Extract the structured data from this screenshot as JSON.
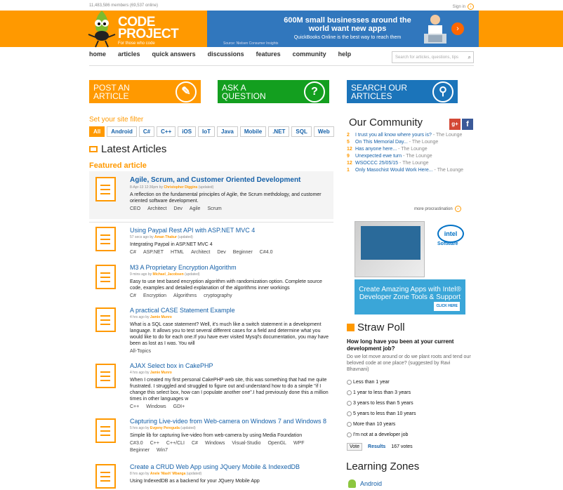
{
  "topbar": {
    "members": "11,483,586 members (69,537 online)",
    "signin": "Sign in"
  },
  "logo": {
    "line1": "CODE",
    "line2": "PROJECT",
    "tagline": "For those who code"
  },
  "ad": {
    "headline": "600M small businesses around the world want new apps",
    "sub": "QuickBooks Online is the best way to reach them",
    "source": "Source: Nielsen Consumer Insights"
  },
  "nav": [
    "home",
    "articles",
    "quick answers",
    "discussions",
    "features",
    "community",
    "help"
  ],
  "search": {
    "placeholder": "Search for articles, questions, tips"
  },
  "actions": {
    "post_article": "POST AN ARTICLE",
    "ask_question": "ASK A QUESTION",
    "search_articles": "SEARCH OUR ARTICLES"
  },
  "filter": {
    "title": "Set your site filter",
    "chips": [
      "All",
      "Android",
      "C#",
      "C++",
      "iOS",
      "IoT",
      "Java",
      "Mobile",
      ".NET",
      "SQL",
      "Web"
    ]
  },
  "latest": {
    "title": "Latest Articles",
    "featured_label": "Featured article"
  },
  "articles": [
    {
      "title": "Agile, Scrum, and Customer Oriented Development",
      "meta": "8-Apr-13 12:36pm by",
      "author": "Christopher Diggins",
      "updated": "(updated)",
      "desc": "A reflection on the fundamental principles of Agile, the Scrum methdology, and customer oriented software development.",
      "tags": [
        "CEO",
        "Architect",
        "Dev",
        "Agile",
        "Scrum"
      ]
    },
    {
      "title": "Using Paypal Rest API with ASP.NET MVC 4",
      "meta": "57 secs ago by",
      "author": "Aman Thakur",
      "updated": "(updated)",
      "desc": "Integrating Paypal in ASP.NET MVC 4",
      "tags": [
        "C#",
        "ASP.NET",
        "HTML",
        "Architect",
        "Dev",
        "Beginner",
        "C#4.0"
      ]
    },
    {
      "title": "M3 A Proprietary Encryption Algorithm",
      "meta": "9 mins ago by",
      "author": "Michael_Jacobsen",
      "updated": "(updated)",
      "desc": "Easy to use text based encryption algorithm with randomization option. Complete source code, examples and detailed explanation of the algorithms inner workings",
      "tags": [
        "C#",
        "Encryption",
        "Algorithms",
        "cryptography"
      ]
    },
    {
      "title": "A practical CASE Statement Example",
      "meta": "4 hrs ago by",
      "author": "Jamie Munro",
      "updated": "",
      "desc": "What is a SQL case statement? Well, it's much like a switch statement in a development language. It allows you to test several different cases for a field and determine what you would like to do for each one.If you have ever visited Mysql's documentation, you may have been as lost as I was. You will",
      "tags": [
        "All-Topics"
      ]
    },
    {
      "title": "AJAX Select box in CakePHP",
      "meta": "4 hrs ago by",
      "author": "Jamie Munro",
      "updated": "",
      "desc": "When I created my first personal CakePHP web site, this was something that had me quite frustrated.  I struggled and struggled to figure out and understand how to do a simple \"if I change this select box, how can I populate another one\".I had previously done this a million times in other languages w",
      "tags": [
        "C++",
        "Windows",
        "GDI+"
      ]
    },
    {
      "title": "Capturing Live-video from Web-camera on Windows 7 and Windows 8",
      "meta": "5 hrs ago by",
      "author": "Evgeny Pereguda",
      "updated": "(updated)",
      "desc": "Simple lib for capturing live-video from web-camera by using Media Foundation",
      "tags": [
        "C#3.0",
        "C++",
        "C++/CLI",
        "C#",
        "Windows",
        "Visual-Studio",
        "OpenGL",
        "WPF",
        "Beginner",
        "Win7"
      ]
    },
    {
      "title": "Create a CRUD Web App using JQuery Mobile & IndexedDB",
      "meta": "8 hrs ago by",
      "author": "Anele 'Mash' Mbanga",
      "updated": "(updated)",
      "desc": "Using IndexedDB as a backend for your JQuery Mobile App",
      "tags": []
    }
  ],
  "community": {
    "title": "Our Community",
    "gplus": "g+",
    "fb": "f",
    "items": [
      {
        "n": "2",
        "q": "I trust you all know where yours is?",
        "c": " - The Lounge"
      },
      {
        "n": "5",
        "q": "On This Memorial Day...",
        "c": " - The Lounge"
      },
      {
        "n": "12",
        "q": "Has anyone here...",
        "c": " - The Lounge"
      },
      {
        "n": "9",
        "q": "Unexpected ewe turn",
        "c": " - The Lounge"
      },
      {
        "n": "12",
        "q": "WSOCCC 25/05/15",
        "c": " - The Lounge"
      },
      {
        "n": "1",
        "q": "Only Masochist Would Work Here...",
        "c": " - The Lounge"
      }
    ],
    "more": "more procrastination"
  },
  "intel_ad": {
    "logo": "intel",
    "software": "Software",
    "text": "Create Amazing Apps with Intel® Developer Zone Tools & Support",
    "click": "CLICK HERE"
  },
  "poll": {
    "title": "Straw Poll",
    "question": "How long have you been at your current development job?",
    "sub": "Do we lot move around or do we plant roots and tend our beloved code at one place? (suggested by Ravi Bhavnani)",
    "options": [
      "Less than 1 year",
      "1 year to less than 3 years",
      "3 years to less than 5 years",
      "5 years to less than 10 years",
      "More than 10 years",
      "I'm not at a developer job"
    ],
    "vote": "Vote",
    "results": "Results",
    "votes": "167 votes"
  },
  "learning": {
    "title": "Learning Zones",
    "android": "Android"
  },
  "colors": {
    "brand": "#ff9900",
    "link": "#1560a8",
    "ask_green": "#139f1f",
    "search_blue": "#1b74ba"
  }
}
